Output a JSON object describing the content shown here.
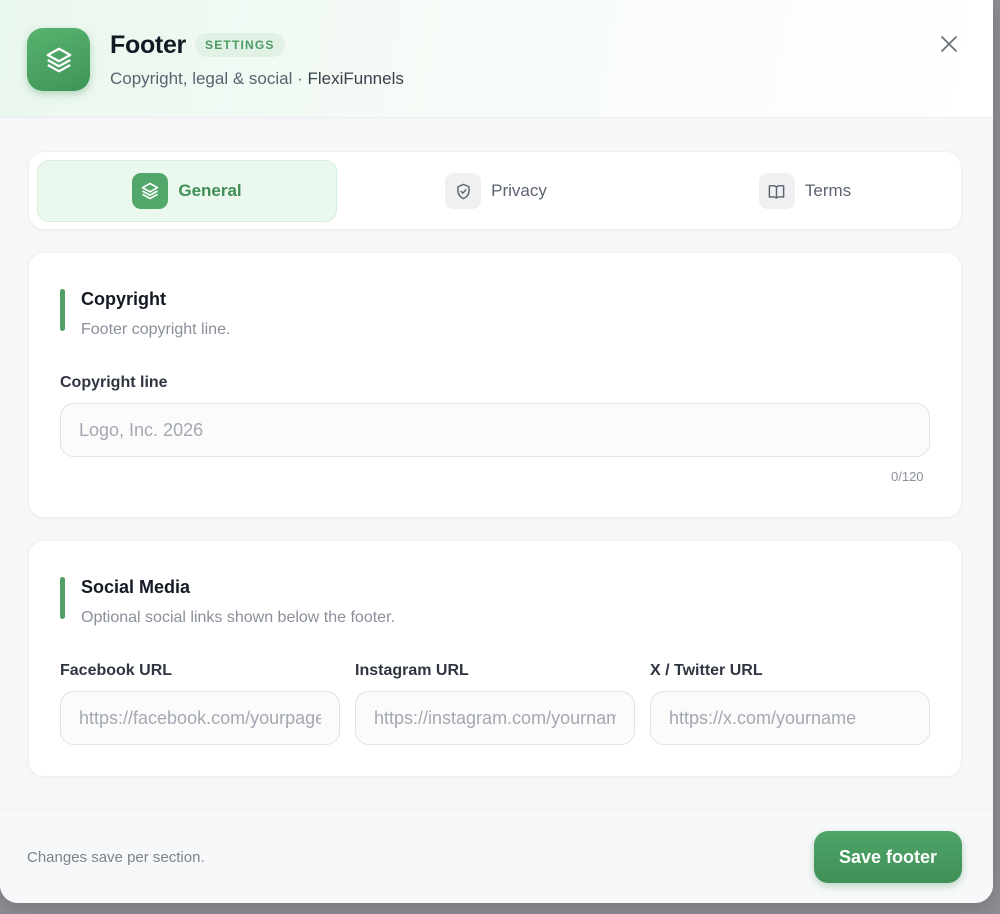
{
  "header": {
    "title": "Footer",
    "badge": "SETTINGS",
    "subtitle": "Copyright, legal & social · ",
    "brand": "FlexiFunnels",
    "icon": "layers-icon",
    "close_icon": "close-icon"
  },
  "tabs": [
    {
      "label": "General",
      "icon": "layers-icon",
      "active": true
    },
    {
      "label": "Privacy",
      "icon": "shield-icon",
      "active": false
    },
    {
      "label": "Terms",
      "icon": "book-icon",
      "active": false
    }
  ],
  "copyright": {
    "title": "Copyright",
    "description": "Footer copyright line.",
    "field_label": "Copyright line",
    "placeholder": "Logo, Inc. 2026",
    "value": "",
    "counter": "0/120"
  },
  "social": {
    "title": "Social Media",
    "description": "Optional social links shown below the footer.",
    "fields": [
      {
        "label": "Facebook URL",
        "placeholder": "https://facebook.com/yourpage"
      },
      {
        "label": "Instagram URL",
        "placeholder": "https://instagram.com/yourname"
      },
      {
        "label": "X / Twitter URL",
        "placeholder": "https://x.com/yourname"
      }
    ]
  },
  "footer": {
    "note": "Changes save per section.",
    "save_label": "Save footer"
  },
  "colors": {
    "accent": "#4f9f66",
    "accent_light": "#eaf8ee",
    "badge_text": "#4b9c63"
  }
}
